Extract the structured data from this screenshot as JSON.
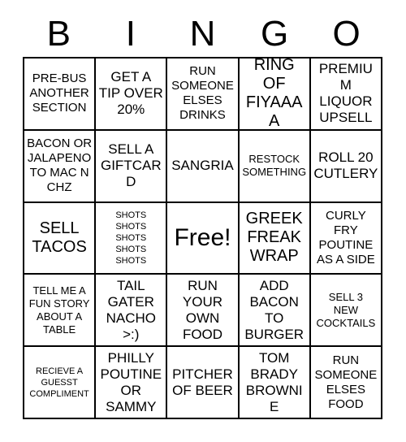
{
  "card": {
    "header_letters": [
      "B",
      "I",
      "N",
      "G",
      "O"
    ],
    "free_space_label": "Free!",
    "colors": {
      "background": "#ffffff",
      "border": "#000000",
      "text": "#000000"
    },
    "rows": [
      [
        {
          "text": "PRE-BUS\nANOTHER\nSECTION",
          "size": "sm"
        },
        {
          "text": "GET A\nTIP OVER\n20%",
          "size": "md"
        },
        {
          "text": "RUN\nSOMEONE\nELSES\nDRINKS",
          "size": "sm"
        },
        {
          "text": "RING OF\nFIYAAAA",
          "size": "lg"
        },
        {
          "text": "PREMIUM\nLIQUOR\nUPSELL",
          "size": "md"
        }
      ],
      [
        {
          "text": "BACON OR\nJALAPENO\nTO MAC N\nCHZ",
          "size": "sm"
        },
        {
          "text": "SELL A\nGIFTCARD",
          "size": "md"
        },
        {
          "text": "SANGRIA",
          "size": "md"
        },
        {
          "text": "RESTOCK\nSOMETHING",
          "size": "xs"
        },
        {
          "text": "ROLL 20\nCUTLERY",
          "size": "md"
        }
      ],
      [
        {
          "text": "SELL\nTACOS",
          "size": "lg"
        },
        {
          "text": "SHOTS\nSHOTS\nSHOTS\nSHOTS\nSHOTS",
          "size": "xxs"
        },
        {
          "text": "Free!",
          "size": "xl"
        },
        {
          "text": "GREEK\nFREAK\nWRAP",
          "size": "lg"
        },
        {
          "text": "CURLY\nFRY\nPOUTINE\nAS A SIDE",
          "size": "sm"
        }
      ],
      [
        {
          "text": "TELL ME A\nFUN STORY\nABOUT A\nTABLE",
          "size": "xs"
        },
        {
          "text": "TAIL\nGATER\nNACHO\n>:)",
          "size": "md"
        },
        {
          "text": "RUN\nYOUR\nOWN\nFOOD",
          "size": "md"
        },
        {
          "text": "ADD\nBACON\nTO\nBURGER",
          "size": "md"
        },
        {
          "text": "SELL 3\nNEW\nCOCKTAILS",
          "size": "xs"
        }
      ],
      [
        {
          "text": "RECIEVE A\nGUESST\nCOMPLIMENT",
          "size": "xxs"
        },
        {
          "text": "PHILLY\nPOUTINE\nOR\nSAMMY",
          "size": "md"
        },
        {
          "text": "PITCHER\nOF BEER",
          "size": "md"
        },
        {
          "text": "TOM\nBRADY\nBROWNIE",
          "size": "md"
        },
        {
          "text": "RUN\nSOMEONE\nELSES\nFOOD",
          "size": "sm"
        }
      ]
    ]
  }
}
